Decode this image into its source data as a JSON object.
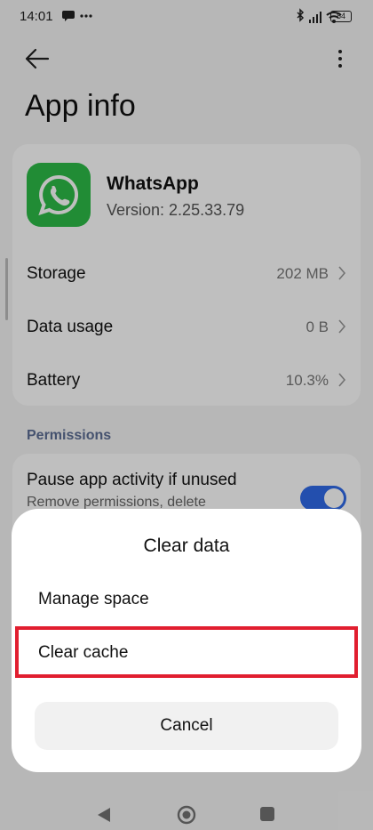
{
  "status_bar": {
    "time": "14:01",
    "battery_level": "84"
  },
  "header": {
    "title": "App info"
  },
  "app": {
    "name": "WhatsApp",
    "version": "Version: 2.25.33.79"
  },
  "rows": [
    {
      "label": "Storage",
      "value": "202 MB"
    },
    {
      "label": "Data usage",
      "value": "0 B"
    },
    {
      "label": "Battery",
      "value": "10.3%"
    }
  ],
  "permissions": {
    "section_label": "Permissions",
    "title": "Pause app activity if unused",
    "subtitle": "Remove permissions, delete",
    "toggle_on": true
  },
  "dialog": {
    "title": "Clear data",
    "options": [
      {
        "label": "Manage space"
      },
      {
        "label": "Clear cache",
        "highlighted": true
      }
    ],
    "cancel_label": "Cancel"
  },
  "colors": {
    "highlight": "#e11e2f",
    "toggle": "#2f6ae8",
    "app_icon": "#2dbb47",
    "section_label": "#5d6e94"
  },
  "icons": {
    "back": "arrow-left-icon",
    "more": "more-vertical-icon",
    "chevron": "chevron-right-icon",
    "nav_back": "triangle-back-icon",
    "nav_home": "circle-home-icon",
    "nav_recents": "square-recents-icon"
  }
}
